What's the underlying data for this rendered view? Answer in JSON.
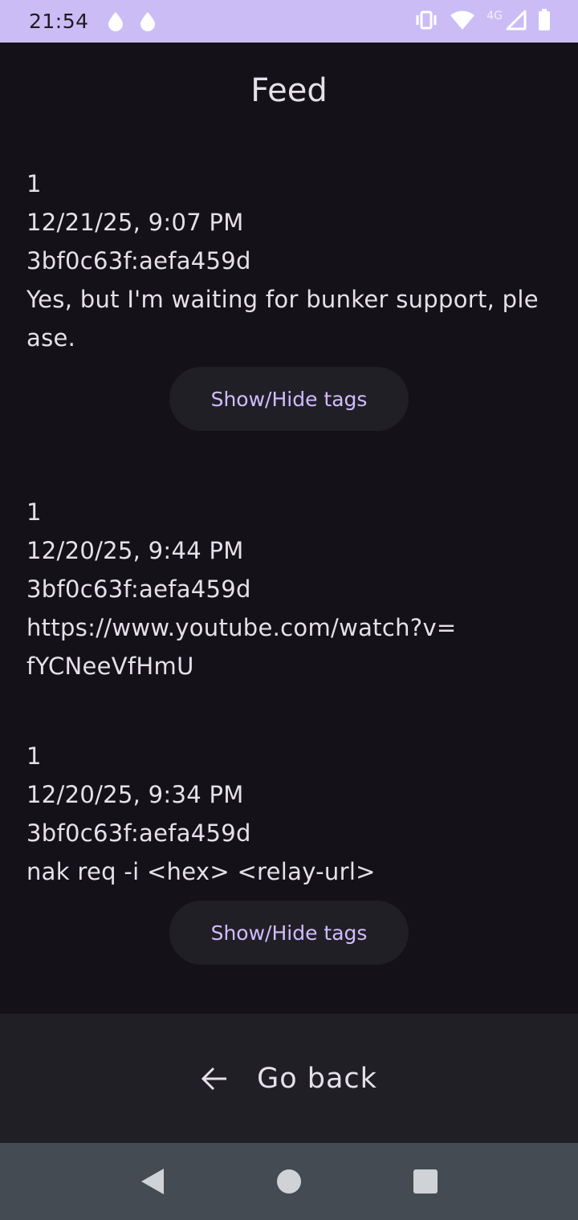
{
  "status_bar": {
    "time": "21:54",
    "network_label": "4G",
    "icons": [
      "water-drop-icon",
      "water-drop-icon",
      "vibrate-icon",
      "wifi-icon",
      "signal-icon",
      "battery-icon"
    ]
  },
  "page": {
    "title": "Feed"
  },
  "feed": [
    {
      "kind": "1",
      "date": "12/21/25, 9:07 PM",
      "author": "3bf0c63f:aefa459d",
      "content": "Yes, but I'm waiting for bunker support, please.",
      "tags_button": "Show/Hide tags"
    },
    {
      "kind": "1",
      "date": "12/20/25, 9:44 PM",
      "author": "3bf0c63f:aefa459d",
      "content": "https://www.youtube.com/watch?v=\nfYCNeeVfHmU"
    },
    {
      "kind": "1",
      "date": "12/20/25, 9:34 PM",
      "author": "3bf0c63f:aefa459d",
      "content": "nak req -i <hex> <relay-url>",
      "tags_button": "Show/Hide tags"
    }
  ],
  "bottom": {
    "go_back_label": "Go back"
  },
  "colors": {
    "status_bar": "#cbbcf6",
    "background": "#141218",
    "surface": "#211f26",
    "accent": "#d0bcff",
    "text": "#e6e0e9",
    "nav_bar": "#454b53"
  }
}
